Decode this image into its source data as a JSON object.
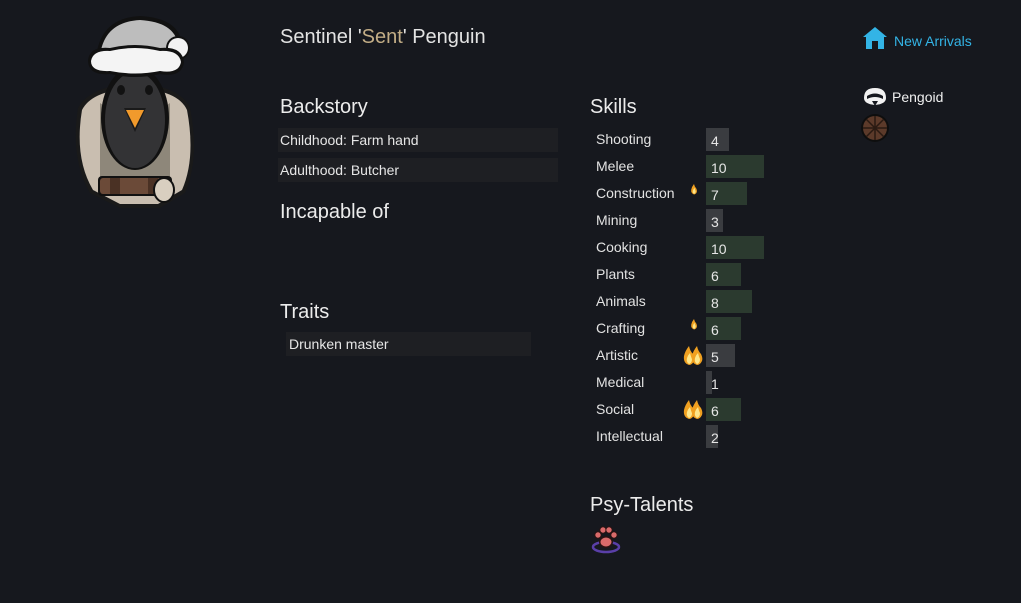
{
  "pawn": {
    "first_name": "Sentinel",
    "nick_open": " '",
    "nickname": "Sent",
    "nick_close": "' ",
    "last_name": "Penguin"
  },
  "backstory": {
    "heading": "Backstory",
    "childhood": "Childhood: Farm hand",
    "adulthood": "Adulthood: Butcher"
  },
  "incapable": {
    "heading": "Incapable of"
  },
  "traits": {
    "heading": "Traits",
    "items": [
      "Drunken master"
    ]
  },
  "skills": {
    "heading": "Skills",
    "max_level": 20,
    "items": [
      {
        "name": "Shooting",
        "level": 4,
        "passion": "none"
      },
      {
        "name": "Melee",
        "level": 10,
        "passion": "none"
      },
      {
        "name": "Construction",
        "level": 7,
        "passion": "minor"
      },
      {
        "name": "Mining",
        "level": 3,
        "passion": "none"
      },
      {
        "name": "Cooking",
        "level": 10,
        "passion": "none"
      },
      {
        "name": "Plants",
        "level": 6,
        "passion": "none"
      },
      {
        "name": "Animals",
        "level": 8,
        "passion": "none"
      },
      {
        "name": "Crafting",
        "level": 6,
        "passion": "minor"
      },
      {
        "name": "Artistic",
        "level": 5,
        "passion": "major"
      },
      {
        "name": "Medical",
        "level": 1,
        "passion": "none"
      },
      {
        "name": "Social",
        "level": 6,
        "passion": "major"
      },
      {
        "name": "Intellectual",
        "level": 2,
        "passion": "none",
        "marked": true
      }
    ]
  },
  "psy_talents": {
    "heading": "Psy-Talents",
    "icon": "paw-talent-icon"
  },
  "faction": {
    "label": "New Arrivals",
    "icon": "house-icon",
    "color": "#33b4e6"
  },
  "xenotype": {
    "label": "Pengoid",
    "icon": "penguin-head-icon"
  },
  "ideoligion": {
    "icon": "ideoligion-wheel-icon"
  },
  "colors": {
    "background": "#16181e",
    "nickname": "#c2ad86",
    "good_bar": "#2b3a2f",
    "bar": "#3a3c40",
    "link": "#33b4e6"
  }
}
